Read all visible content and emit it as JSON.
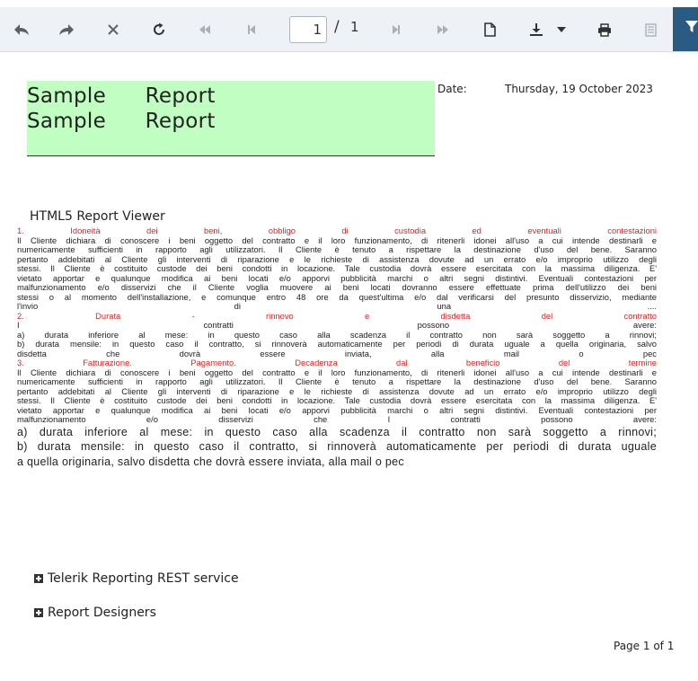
{
  "toolbar": {
    "page_number": "1",
    "page_separator": "/",
    "page_total": "1",
    "icons": [
      "back-icon",
      "forward-icon",
      "stop-icon",
      "refresh-icon",
      "first-page-icon",
      "previous-page-icon",
      "next-page-icon",
      "last-page-icon",
      "document-icon",
      "export-icon",
      "dropdown-icon",
      "print-icon",
      "document-map-icon",
      "filter-icon"
    ]
  },
  "report": {
    "banner_line1": "Sample Report",
    "banner_line2": "Sample Report",
    "banner_color": "#c1fec1",
    "date_label": "Date:",
    "date_value": "Thursday, 19 October 2023",
    "viewer_title": "HTML5 Report Viewer",
    "lines": [
      {
        "text": "1. Idoneità dei beni, obbligo di custodia ed eventuali contestazioni",
        "style": "red"
      },
      {
        "text": "Il Cliente dichiara di conoscere i beni oggetto del contratto e il loro funzionamento, di ritenerli idonei all'uso a cui intende destinarli e",
        "style": ""
      },
      {
        "text": "numericamente sufficienti in rapporto agli utilizzatori. Il Cliente è tenuto a rispettare la destinazione d'uso del bene. Saranno",
        "style": ""
      },
      {
        "text": "pertanto addebitati al Cliente gli interventi di riparazione e le richieste di assistenza dovute ad un errato e/o improprio utilizzo degli",
        "style": ""
      },
      {
        "text": "stessi. Il Cliente è costituito custode dei beni condotti in locazione. Tale custodia dovrà essere esercitata con la massima diligenza. E'",
        "style": ""
      },
      {
        "text": "vietato apportar e qualunque modifica ai beni locati e/o apporvi pubblicità marchi o altri segni distintivi. Eventuali contestazioni per",
        "style": ""
      },
      {
        "text": "malfunzionamento e/o disservizi che il Cliente voglia muovere ai beni locati dovranno essere effettuate prima dell'utilizzo dei beni",
        "style": ""
      },
      {
        "text": "stessi o al momento dell'installazione, e comunque entro 48 ore da quest'ultima e/o dal verificarsi del presunto disservizio, mediante",
        "style": ""
      },
      {
        "text": "l'invio di una ....",
        "style": ""
      },
      {
        "text": "2. Durata - rinnovo e disdetta del contratto",
        "style": "red"
      },
      {
        "text": "I contratti possono avere:",
        "style": ""
      },
      {
        "text": "a) durata inferiore al mese: in questo caso alla scadenza il contratto non sarà soggetto a rinnovi;",
        "style": ""
      },
      {
        "text": "b) durata mensile: in questo caso il contratto, si rinnoverà automaticamente per periodi di durata uguale a quella originaria, salvo",
        "style": ""
      },
      {
        "text": "disdetta che dovrà essere inviata, alla mail o pec",
        "style": ""
      },
      {
        "text": "3. Fatturazione. Pagamento. Decadenza dal beneficio del termine",
        "style": "red"
      },
      {
        "text": "Il Cliente dichiara di conoscere i beni oggetto del contratto e il loro funzionamento, di ritenerli idonei all'uso a cui intende destinarli e",
        "style": ""
      },
      {
        "text": "numericamente sufficienti in rapporto agli utilizzatori. Il Cliente è tenuto a rispettare la destinazione d'uso del bene. Saranno",
        "style": ""
      },
      {
        "text": "pertanto addebitati al Cliente gli interventi di riparazione e le richieste di assistenza dovute ad un errato e/o improprio utilizzo degli",
        "style": ""
      },
      {
        "text": "stessi. Il Cliente è costituito custode dei beni condotti in locazione. Tale custodia dovrà essere esercitata con la massima diligenza. E'",
        "style": ""
      },
      {
        "text": "vietato apportar e qualunque modifica ai beni locati e/o apporvi pubblicità marchi o altri segni distintivi. Eventuali contestazioni per",
        "style": ""
      },
      {
        "text": "malfunzionamento e/o disservizi che I contratti possono avere:",
        "style": ""
      },
      {
        "text": "a) durata inferiore al mese: in questo caso alla scadenza il contratto non sarà soggetto a rinnovi;",
        "style": "big"
      },
      {
        "text": "b) durata mensile: in questo caso il contratto, si rinnoverà automaticamente per periodi di durata uguale",
        "style": "big"
      },
      {
        "text": "a quella originaria, salvo disdetta che dovrà essere inviata, alla mail o pec",
        "style": "big last"
      }
    ]
  },
  "sections": [
    {
      "label": "Telerik Reporting REST service"
    },
    {
      "label": "Report Designers"
    }
  ],
  "footer": {
    "page_label": "Page 1 of 1"
  }
}
